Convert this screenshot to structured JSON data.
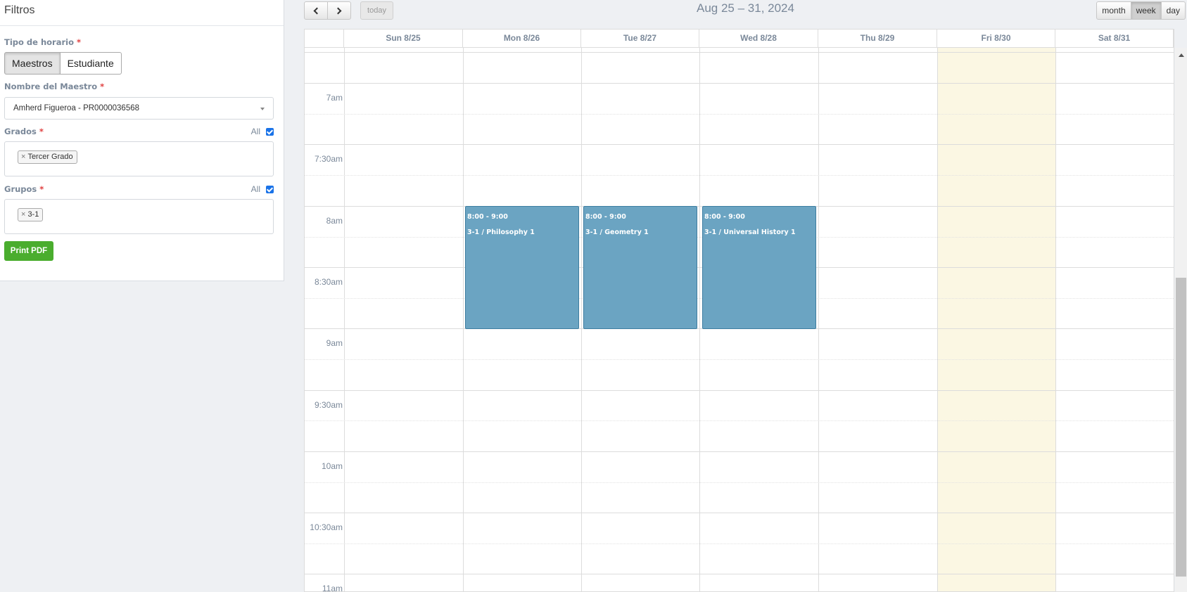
{
  "filters": {
    "title": "Filtros",
    "schedule_type": {
      "label": "Tipo de horario",
      "required_mark": "*",
      "options": [
        "Maestros",
        "Estudiante"
      ],
      "selected": "Maestros"
    },
    "teacher": {
      "label": "Nombre del Maestro",
      "required_mark": "*",
      "value": "Amherd Figueroa - PR0000036568"
    },
    "grades": {
      "label": "Grados",
      "required_mark": "*",
      "all_label": "All",
      "all_checked": true,
      "tags": [
        "Tercer Grado"
      ]
    },
    "groups": {
      "label": "Grupos",
      "required_mark": "*",
      "all_label": "All",
      "all_checked": true,
      "tags": [
        "3-1"
      ]
    },
    "print_button": "Print PDF",
    "tag_remove_glyph": "×"
  },
  "toolbar": {
    "prev_icon": "chevron-left-icon",
    "next_icon": "chevron-right-icon",
    "today_label": "today",
    "title": "Aug 25 – 31, 2024",
    "views": [
      "month",
      "week",
      "day"
    ],
    "active_view": "week"
  },
  "calendar": {
    "days": [
      "Sun 8/25",
      "Mon 8/26",
      "Tue 8/27",
      "Wed 8/28",
      "Thu 8/29",
      "Fri 8/30",
      "Sat 8/31"
    ],
    "highlighted_day": "Fri 8/30",
    "time_labels": [
      "7am",
      "7:30am",
      "8am",
      "8:30am",
      "9am",
      "9:30am",
      "10am",
      "10:30am",
      "11am"
    ],
    "events": [
      {
        "day": "Mon 8/26",
        "time": "8:00 - 9:00",
        "title": "3-1 / Philosophy 1"
      },
      {
        "day": "Tue 8/27",
        "time": "8:00 - 9:00",
        "title": "3-1 / Geometry 1"
      },
      {
        "day": "Wed 8/28",
        "time": "8:00 - 9:00",
        "title": "3-1 / Universal History 1"
      }
    ],
    "colors": {
      "event_bg": "#6ba4c2",
      "today_bg": "#fbf7e3",
      "accent_green": "#4aad2e"
    }
  }
}
